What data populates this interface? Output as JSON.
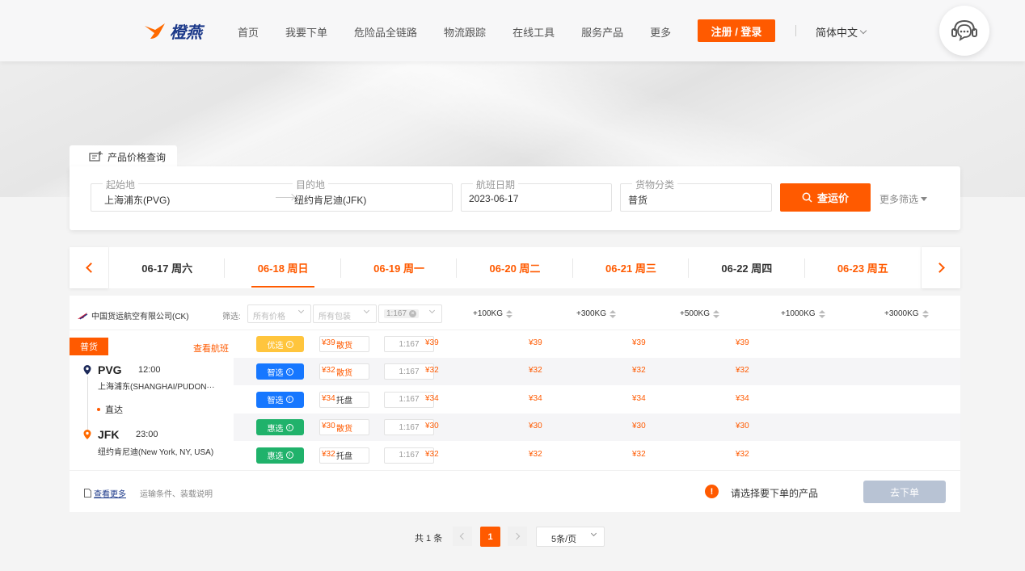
{
  "brand": {
    "name": "橙燕",
    "logo_color": "#ff6a00",
    "text_color": "#1d3a8a"
  },
  "nav": {
    "items": [
      "首页",
      "我要下单",
      "危险品全链路",
      "物流跟踪",
      "在线工具",
      "服务产品",
      "更多"
    ],
    "login_label": "注册 / 登录",
    "language": "简体中文",
    "support_icon": "chat-support-icon"
  },
  "query": {
    "tab_label": "产品价格查询",
    "origin_label": "起始地",
    "origin_value": "上海浦东(PVG)",
    "dest_label": "目的地",
    "dest_value": "纽约肯尼迪(JFK)",
    "date_label": "航班日期",
    "date_value": "2023-06-17",
    "cargo_label": "货物分类",
    "cargo_value": "普货",
    "search_label": "查运价",
    "more_filter_label": "更多筛选"
  },
  "dates": [
    {
      "label": "06-17 周六",
      "color": "#333333",
      "active": false
    },
    {
      "label": "06-18 周日",
      "color": "#ff5a00",
      "active": true
    },
    {
      "label": "06-19 周一",
      "color": "#ff5a00",
      "active": false
    },
    {
      "label": "06-20 周二",
      "color": "#ff5a00",
      "active": false
    },
    {
      "label": "06-21 周三",
      "color": "#ff5a00",
      "active": false
    },
    {
      "label": "06-22 周四",
      "color": "#333333",
      "active": false
    },
    {
      "label": "06-23 周五",
      "color": "#ff5a00",
      "active": false
    }
  ],
  "results": {
    "airline": "中国货运航空有限公司(CK)",
    "filter_label": "筛选:",
    "filter_price": "所有价格",
    "filter_pack": "所有包装",
    "filter_ratio": "1:167",
    "weight_columns": [
      "+100KG",
      "+300KG",
      "+500KG",
      "+1000KG",
      "+3000KG"
    ],
    "cargo_tag": "普货",
    "view_flights": "查看航班",
    "route": {
      "from_code": "PVG",
      "from_time": "12:00",
      "from_name": "上海浦东(SHANGHAI/PUDON···",
      "direct": "直达",
      "to_code": "JFK",
      "to_time": "23:00",
      "to_name": "纽约肯尼迪(New York, NY, USA)"
    },
    "rows": [
      {
        "badge": "优选",
        "badge_color": "#ffc53d",
        "type": "散货",
        "ratio": "1:167",
        "prices": [
          "¥39",
          "¥39",
          "¥39",
          "¥39",
          "¥39"
        ]
      },
      {
        "badge": "智选",
        "badge_color": "#1677ff",
        "type": "散货",
        "ratio": "1:167",
        "prices": [
          "¥32",
          "¥32",
          "¥32",
          "¥32",
          "¥32"
        ]
      },
      {
        "badge": "智选",
        "badge_color": "#1677ff",
        "type": "托盘",
        "ratio": "1:167",
        "prices": [
          "¥34",
          "¥34",
          "¥34",
          "¥34",
          "¥34"
        ]
      },
      {
        "badge": "惠选",
        "badge_color": "#20b26b",
        "type": "散货",
        "ratio": "1:167",
        "prices": [
          "¥30",
          "¥30",
          "¥30",
          "¥30",
          "¥30"
        ]
      },
      {
        "badge": "惠选",
        "badge_color": "#20b26b",
        "type": "托盘",
        "ratio": "1:167",
        "prices": [
          "¥32",
          "¥32",
          "¥32",
          "¥32",
          "¥32"
        ]
      }
    ],
    "view_more": "查看更多",
    "terms": "运输条件、装载说明",
    "warning": "请选择要下单的产品",
    "order_label": "去下单"
  },
  "pagination": {
    "total": "共 1 条",
    "current": "1",
    "page_size": "5条/页"
  }
}
